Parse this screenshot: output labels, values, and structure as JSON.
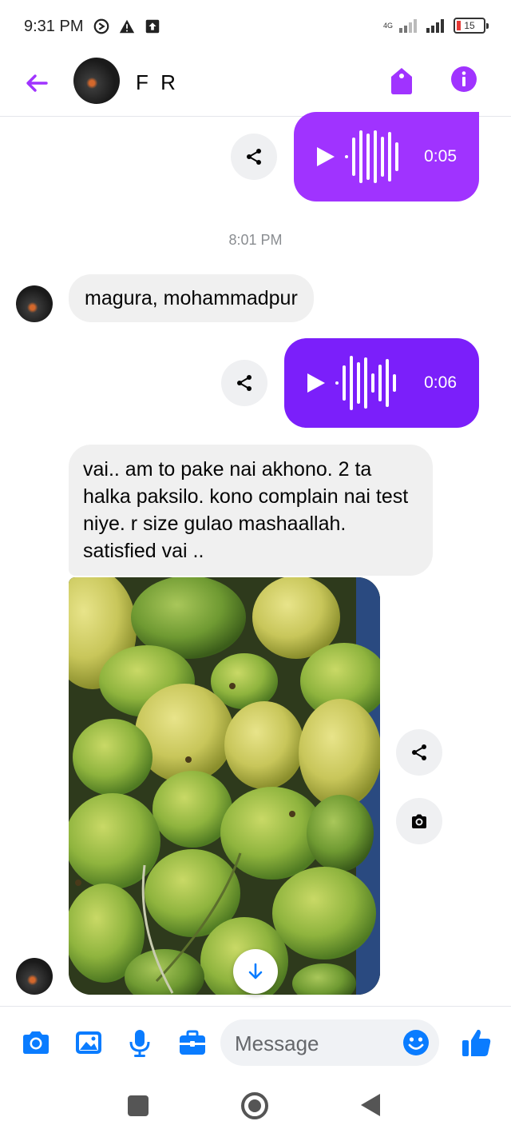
{
  "status_bar": {
    "time": "9:31 PM",
    "network": "4G",
    "battery": "15"
  },
  "header": {
    "contact_name": "F R"
  },
  "messages": {
    "voice_1": {
      "duration": "0:05"
    },
    "timestamp": "8:01 PM",
    "incoming_1": {
      "text": "magura, mohammadpur"
    },
    "voice_2": {
      "duration": "0:06"
    },
    "incoming_2": {
      "text": "vai.. am to pake nai akhono. 2 ta halka paksilo. kono complain nai test niye. r size gulao mashaallah. satisfied vai .."
    }
  },
  "composer": {
    "placeholder": "Message"
  },
  "colors": {
    "accent": "#a033ff",
    "accent_dark": "#7b1ffa",
    "messenger_blue": "#0a7cff",
    "bubble_gray": "#f0f0f0"
  },
  "icons": [
    "back-arrow-icon",
    "tag-icon",
    "info-icon",
    "share-icon",
    "play-icon",
    "camera-icon",
    "gallery-icon",
    "microphone-icon",
    "briefcase-icon",
    "emoji-icon",
    "thumbs-up-icon",
    "arrow-down-icon"
  ]
}
